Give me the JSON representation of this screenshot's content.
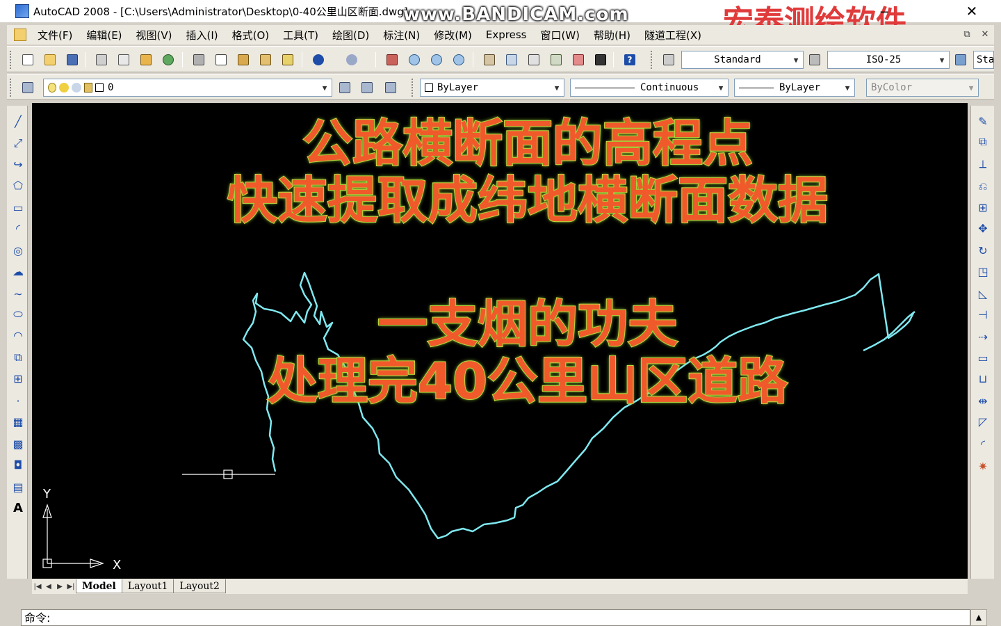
{
  "window": {
    "title": "AutoCAD 2008 - [C:\\Users\\Administrator\\Desktop\\0-40公里山区断面.dwg]",
    "watermark": "www.BANDICAM.com",
    "brand": "宏泰测绘软件",
    "controls": {
      "minimize": "‒",
      "close": "✕",
      "restore": "⧉"
    }
  },
  "menubar": {
    "items": [
      "文件(F)",
      "编辑(E)",
      "视图(V)",
      "插入(I)",
      "格式(O)",
      "工具(T)",
      "绘图(D)",
      "标注(N)",
      "修改(M)",
      "Express",
      "窗口(W)",
      "帮助(H)",
      "隧道工程(X)"
    ]
  },
  "toolbar_standard": {
    "text_style": "Standard",
    "dim_style": "ISO-25",
    "table_style": "Sta"
  },
  "toolbar_layers": {
    "layer": "0",
    "color": "ByLayer",
    "linetype": "Continuous",
    "lineweight": "ByLayer",
    "plotstyle": "ByColor"
  },
  "canvas": {
    "overlay": {
      "line1": "公路横断面的高程点",
      "line2": "快速提取成纬地横断面数据",
      "line3": "一支烟的功夫",
      "line4": "处理完40公里山区道路"
    },
    "ucs": {
      "x_label": "X",
      "y_label": "Y"
    },
    "colors": {
      "background": "#000000",
      "profile": "#7fe8f0",
      "crosshair": "#ffffff"
    }
  },
  "layout_tabs": [
    "Model",
    "Layout1",
    "Layout2"
  ],
  "command_line": {
    "prompt": "命令:"
  }
}
